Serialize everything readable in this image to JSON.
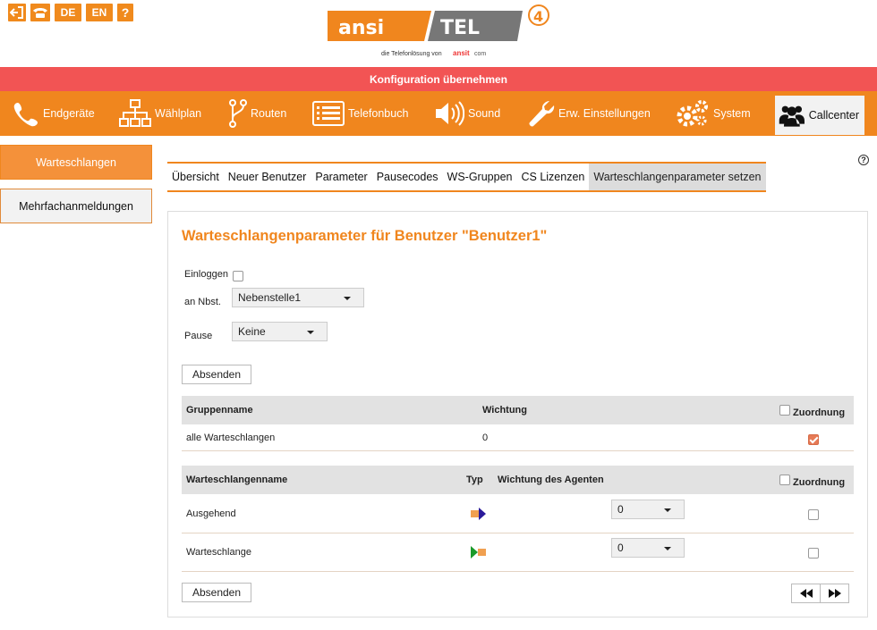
{
  "top_icons": [
    {
      "name": "logout-icon"
    },
    {
      "name": "phone-icon"
    },
    {
      "name": "lang-de",
      "label": "DE"
    },
    {
      "name": "lang-en",
      "label": "EN"
    },
    {
      "name": "help-icon",
      "label": "?"
    }
  ],
  "logo": {
    "text_left": "ansi",
    "text_right": "TEL",
    "badge": "4",
    "tagline": "die Telefonlösung von",
    "tagline_brand": "ansit",
    "tagline_brand_suffix": "com"
  },
  "config_bar": {
    "label": "Konfiguration übernehmen"
  },
  "nav": {
    "items": [
      {
        "label": "Endgeräte",
        "icon": "phone-icon"
      },
      {
        "label": "Wählplan",
        "icon": "dialplan-icon"
      },
      {
        "label": "Routen",
        "icon": "routes-icon"
      },
      {
        "label": "Telefonbuch",
        "icon": "phonebook-icon"
      },
      {
        "label": "Sound",
        "icon": "sound-icon"
      },
      {
        "label": "Erw. Einstellungen",
        "icon": "wrench-icon"
      },
      {
        "label": "System",
        "icon": "gears-icon"
      },
      {
        "label": "Callcenter",
        "icon": "users-icon"
      }
    ]
  },
  "sidebar": {
    "items": [
      {
        "label": "Warteschlangen"
      },
      {
        "label": "Mehrfachanmeldungen"
      }
    ]
  },
  "help": {
    "label": "?"
  },
  "tabs": [
    {
      "label": "Übersicht"
    },
    {
      "label": "Neuer Benutzer"
    },
    {
      "label": "Parameter"
    },
    {
      "label": "Pausecodes"
    },
    {
      "label": "WS-Gruppen"
    },
    {
      "label": "CS Lizenzen"
    },
    {
      "label": "Warteschlangenparameter setzen"
    }
  ],
  "main": {
    "title": "Warteschlangenparameter für Benutzer \"Benutzer1\"",
    "login_label": "Einloggen",
    "extension_label": "an Nbst.",
    "extension_value": "Nebenstelle1",
    "pause_label": "Pause",
    "pause_value": "Keine",
    "submit_label": "Absenden"
  },
  "group_table": {
    "headers": {
      "name": "Gruppenname",
      "weight": "Wichtung",
      "assign": "Zuordnung"
    },
    "rows": [
      {
        "name": "alle Warteschlangen",
        "weight": "0",
        "assigned": true
      }
    ]
  },
  "queue_table": {
    "headers": {
      "name": "Warteschlangenname",
      "type": "Typ",
      "agent_weight": "Wichtung des Agenten",
      "assign": "Zuordnung"
    },
    "rows": [
      {
        "name": "Ausgehend",
        "type": "outgoing-icon",
        "agent_weight": "0",
        "assigned": false
      },
      {
        "name": "Warteschlange",
        "type": "incoming-icon",
        "agent_weight": "0",
        "assigned": false
      }
    ]
  },
  "footer": {
    "submit_label": "Absenden",
    "prev_icon": "rewind-icon",
    "next_icon": "forward-icon"
  },
  "colors": {
    "accent": "#f0861e",
    "config_bar": "#f25454",
    "header_gray": "#e2e2e2"
  }
}
